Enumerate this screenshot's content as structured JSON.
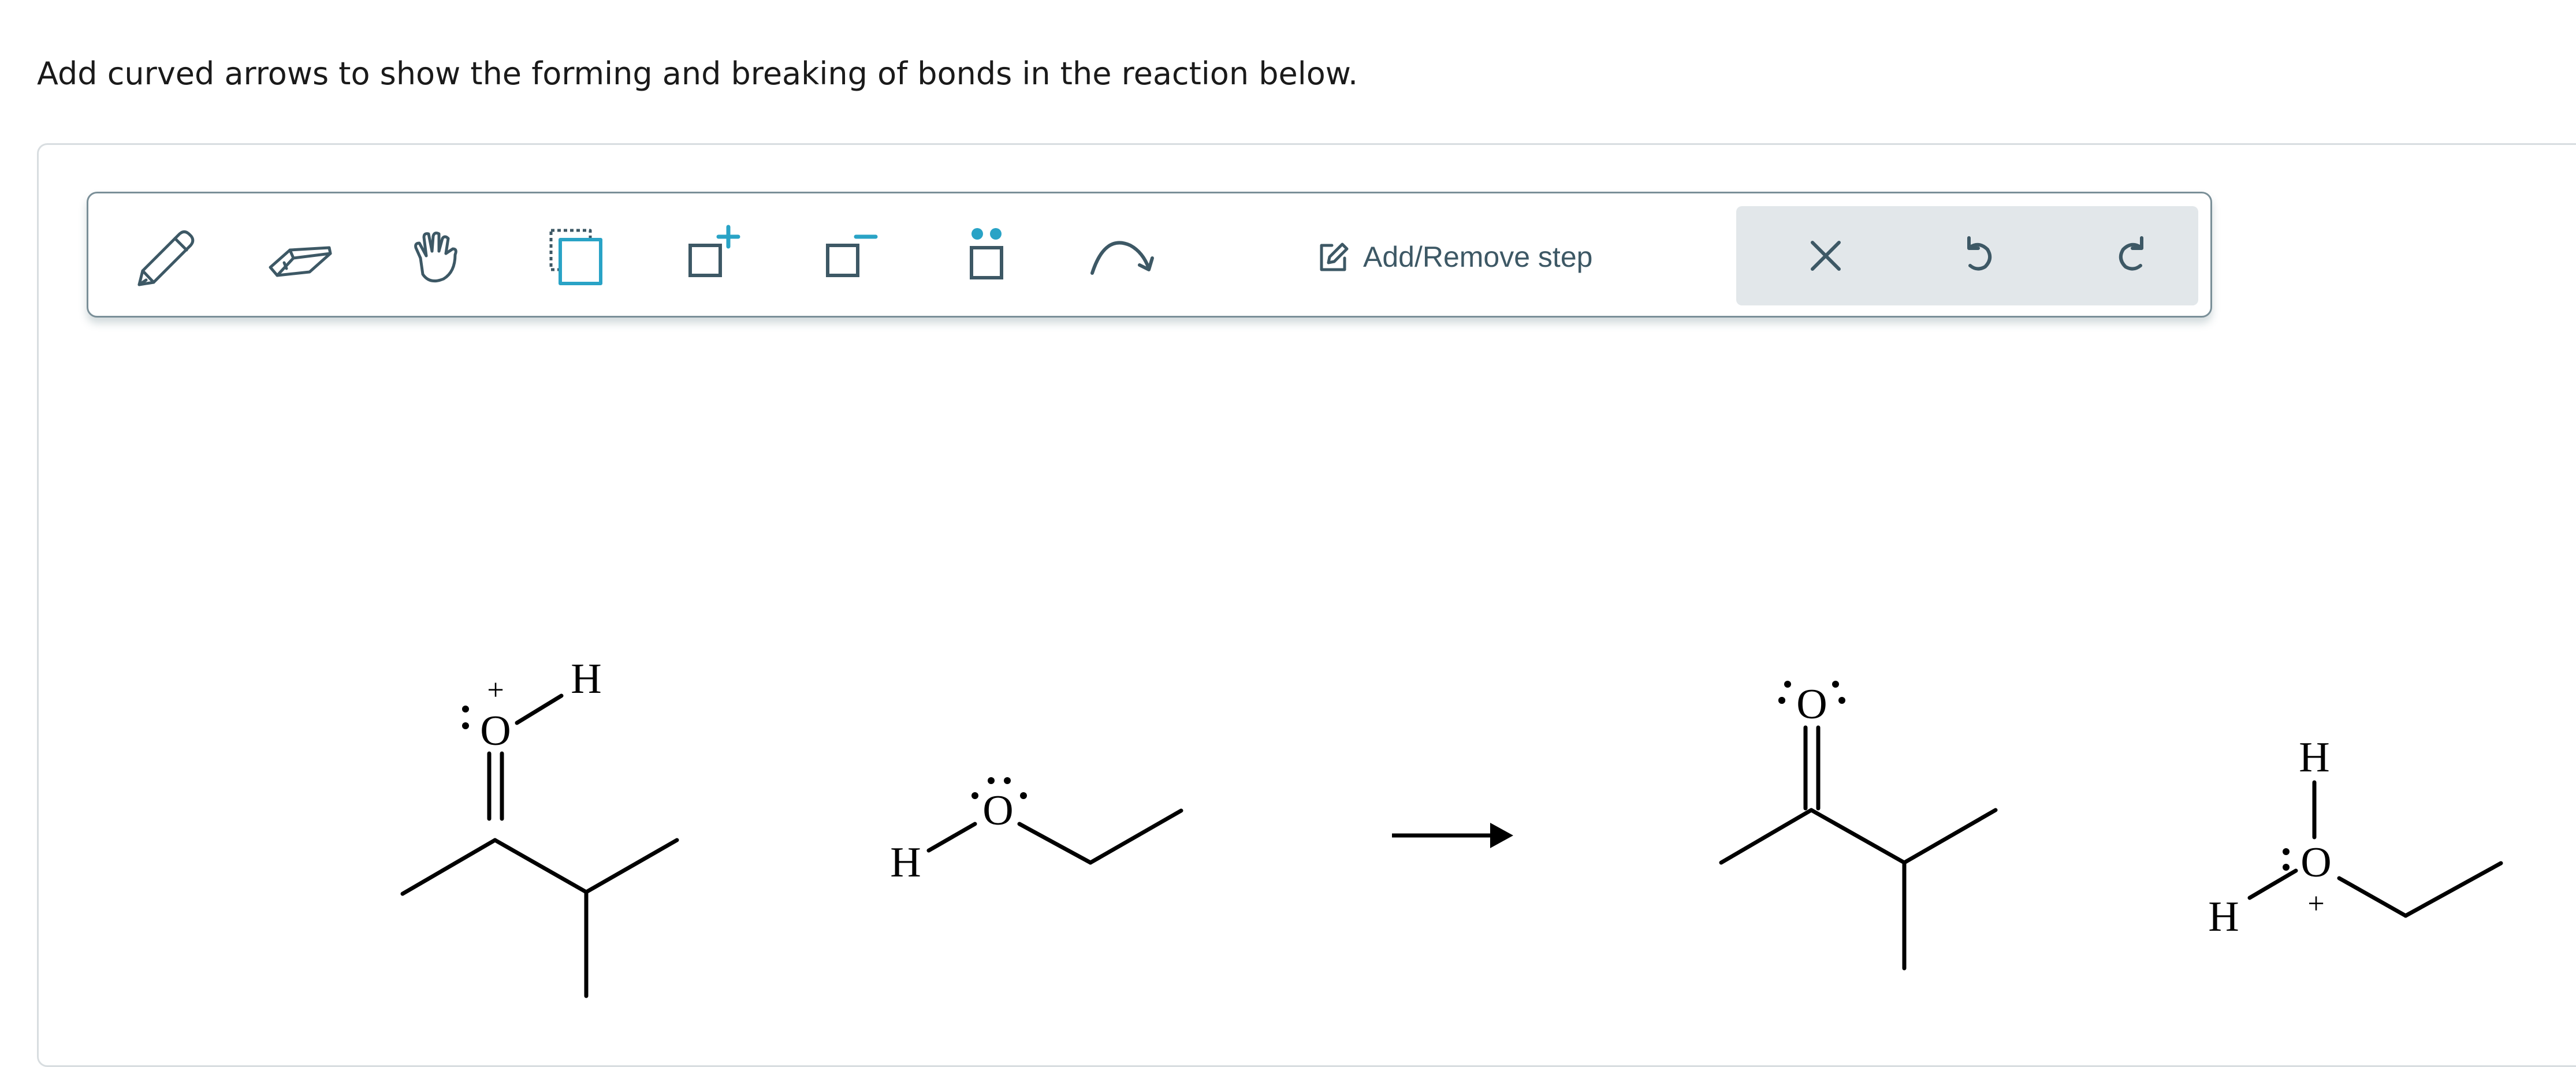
{
  "question": {
    "text": "Add curved arrows to show the forming and breaking of bonds in the reaction below."
  },
  "toolbar": {
    "tools": [
      {
        "name": "pencil-icon",
        "label": "Draw"
      },
      {
        "name": "eraser-icon",
        "label": "Erase"
      },
      {
        "name": "hand-icon",
        "label": "Move"
      },
      {
        "name": "select-icon",
        "label": "Select"
      },
      {
        "name": "add-charge-icon",
        "label": "Add positive charge"
      },
      {
        "name": "remove-charge-icon",
        "label": "Add negative charge"
      },
      {
        "name": "lone-pair-icon",
        "label": "Add lone pair"
      },
      {
        "name": "curved-arrow-icon",
        "label": "Curved arrow"
      }
    ],
    "step_label": "Add/Remove step",
    "actions": [
      {
        "name": "clear-icon"
      },
      {
        "name": "undo-icon"
      },
      {
        "name": "redo-icon"
      }
    ],
    "accent_color": "#29a3c6",
    "icon_color": "#3d5865"
  },
  "molecules": {
    "reactant1": {
      "atoms": [
        "O",
        "H"
      ],
      "charge": "+"
    },
    "reactant2": {
      "atoms": [
        "H",
        "O"
      ]
    },
    "product1": {
      "atoms": [
        "O"
      ]
    },
    "product2": {
      "atoms": [
        "H",
        "H",
        "O"
      ],
      "charge": "+"
    }
  },
  "labels": {
    "o": "O",
    "h": "H",
    "plus": "+"
  }
}
